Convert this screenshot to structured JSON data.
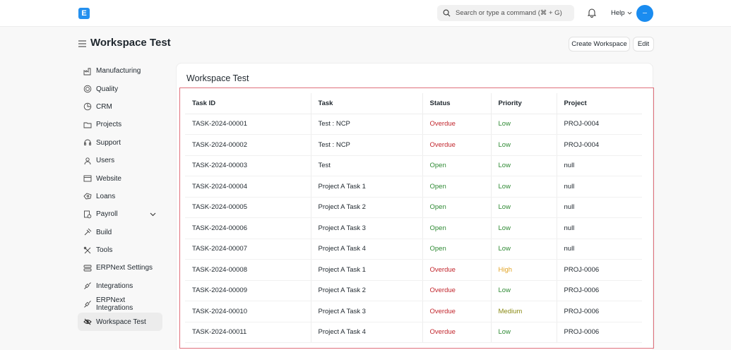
{
  "navbar": {
    "logo_letter": "E",
    "search_placeholder": "Search or type a command (⌘ + G)",
    "help_label": "Help",
    "avatar_initials": "—"
  },
  "header": {
    "title": "Workspace Test",
    "create_label": "Create Workspace",
    "edit_label": "Edit"
  },
  "sidebar": {
    "items": [
      {
        "label": "Manufacturing",
        "icon": "factory-icon"
      },
      {
        "label": "Quality",
        "icon": "quality-badge-icon"
      },
      {
        "label": "CRM",
        "icon": "crm-icon"
      },
      {
        "label": "Projects",
        "icon": "folder-icon"
      },
      {
        "label": "Support",
        "icon": "headset-icon"
      },
      {
        "label": "Users",
        "icon": "users-icon"
      },
      {
        "label": "Website",
        "icon": "website-icon"
      },
      {
        "label": "Loans",
        "icon": "loans-icon"
      },
      {
        "label": "Payroll",
        "icon": "payroll-icon"
      },
      {
        "label": "Build",
        "icon": "build-icon"
      },
      {
        "label": "Tools",
        "icon": "tools-icon"
      },
      {
        "label": "ERPNext Settings",
        "icon": "settings-icon"
      },
      {
        "label": "Integrations",
        "icon": "integrations-icon"
      },
      {
        "label": "ERPNext Integrations",
        "icon": "integrations-icon"
      },
      {
        "label": "Workspace Test",
        "icon": "eye-slash-icon"
      }
    ]
  },
  "card": {
    "title": "Workspace Test",
    "columns": [
      "Task ID",
      "Task",
      "Status",
      "Priority",
      "Project"
    ],
    "rows": [
      [
        "TASK-2024-00001",
        "Test : NCP",
        "Overdue",
        "Low",
        "PROJ-0004"
      ],
      [
        "TASK-2024-00002",
        "Test : NCP",
        "Overdue",
        "Low",
        "PROJ-0004"
      ],
      [
        "TASK-2024-00003",
        "Test",
        "Open",
        "Low",
        "null"
      ],
      [
        "TASK-2024-00004",
        "Project A Task 1",
        "Open",
        "Low",
        "null"
      ],
      [
        "TASK-2024-00005",
        "Project A Task 2",
        "Open",
        "Low",
        "null"
      ],
      [
        "TASK-2024-00006",
        "Project A Task 3",
        "Open",
        "Low",
        "null"
      ],
      [
        "TASK-2024-00007",
        "Project A Task 4",
        "Open",
        "Low",
        "null"
      ],
      [
        "TASK-2024-00008",
        "Project A Task 1",
        "Overdue",
        "High",
        "PROJ-0006"
      ],
      [
        "TASK-2024-00009",
        "Project A Task 2",
        "Overdue",
        "Low",
        "PROJ-0006"
      ],
      [
        "TASK-2024-00010",
        "Project A Task 3",
        "Overdue",
        "Medium",
        "PROJ-0006"
      ],
      [
        "TASK-2024-00011",
        "Project A Task 4",
        "Overdue",
        "Low",
        "PROJ-0006"
      ]
    ]
  },
  "colors": {
    "accent": "#2490ef",
    "overdue": "#c2262d",
    "open": "#2f8a34",
    "low": "#2f8a34",
    "high": "#e2a528",
    "medium": "#8a8a14"
  }
}
